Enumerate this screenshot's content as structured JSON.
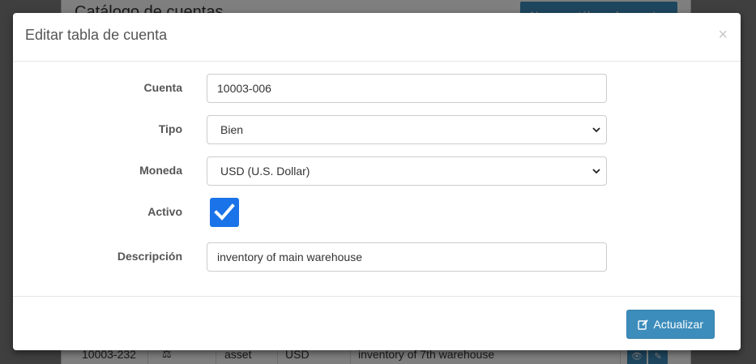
{
  "background": {
    "title": "Catálogo de cuentas",
    "new_button_label": "Nuevo catálogo de cuentas",
    "row": {
      "account": "10003-232",
      "type": "asset",
      "currency": "USD",
      "description": "inventory of 7th warehouse"
    }
  },
  "modal": {
    "title": "Editar tabla de cuenta",
    "close_label": "×",
    "fields": {
      "cuenta": {
        "label": "Cuenta",
        "value": "10003-006"
      },
      "tipo": {
        "label": "Tipo",
        "value": "Bien"
      },
      "moneda": {
        "label": "Moneda",
        "value": "USD (U.S. Dollar)"
      },
      "activo": {
        "label": "Activo",
        "checked": true
      },
      "descripcion": {
        "label": "Descripción",
        "value": "inventory of main warehouse"
      }
    },
    "submit_label": "Actualizar"
  },
  "colors": {
    "primary": "#3c8dbc",
    "checkbox": "#1a73e8"
  }
}
